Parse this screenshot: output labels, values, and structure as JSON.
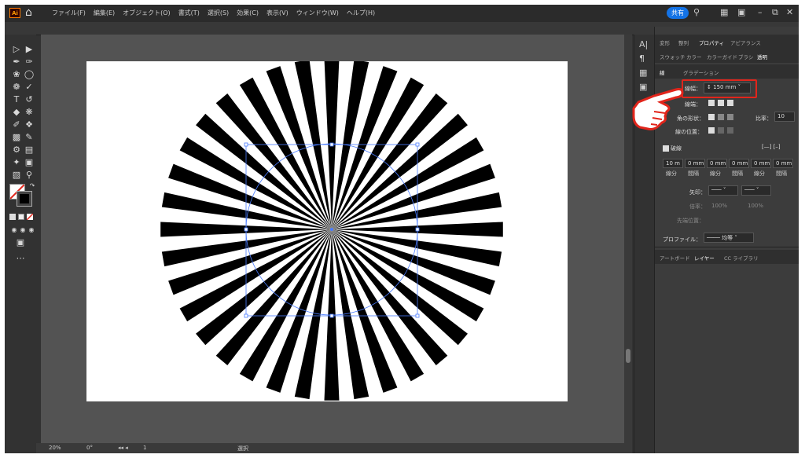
{
  "app": {
    "logo": "Ai"
  },
  "menu": [
    "ファイル(F)",
    "編集(E)",
    "オブジェクト(O)",
    "書式(T)",
    "選択(S)",
    "効果(C)",
    "表示(V)",
    "ウィンドウ(W)",
    "ヘルプ(H)"
  ],
  "topbar": {
    "share_label": "共有",
    "icons": [
      "home-icon",
      "search-icon",
      "arrange-icon",
      "window-icon",
      "minimize-icon",
      "restore-icon",
      "close-icon"
    ]
  },
  "panel_tabs_1": [
    "変形",
    "整列",
    "プロパティ",
    "アピアランス"
  ],
  "panel_tabs_2": [
    "スウォッチ",
    "カラー",
    "カラーガイド",
    "ブラシ",
    "透明"
  ],
  "stroke_tabs": [
    "線",
    "グラデーション"
  ],
  "stroke": {
    "weight_label": "線幅：",
    "weight_value": "150 mm",
    "cap_label": "線端：",
    "corner_label": "角の形状：",
    "limit_label": "比率：",
    "limit_value": "10",
    "align_label": "線の位置："
  },
  "dashed": {
    "label": "破線",
    "values": [
      "10 m",
      "0 mm",
      "0 mm",
      "0 mm",
      "0 mm",
      "0 mm"
    ],
    "labels": [
      "線分",
      "間隔",
      "線分",
      "間隔",
      "線分",
      "間隔"
    ]
  },
  "arrow": {
    "label": "矢印：",
    "scale_label": "倍率：",
    "scale_1": "100%",
    "scale_2": "100%",
    "align_label": "先端位置："
  },
  "profile": {
    "label": "プロファイル：",
    "value": "均等"
  },
  "bottom_tabs": [
    "アートボード",
    "レイヤー",
    "CC ライブラリ"
  ],
  "status": {
    "zoom": "20%",
    "rotate": "0°",
    "page": "1",
    "mode": "選択"
  },
  "colors": {
    "accent": "#1473e6",
    "highlight": "#e1251b",
    "pointer": "#e1251b"
  }
}
